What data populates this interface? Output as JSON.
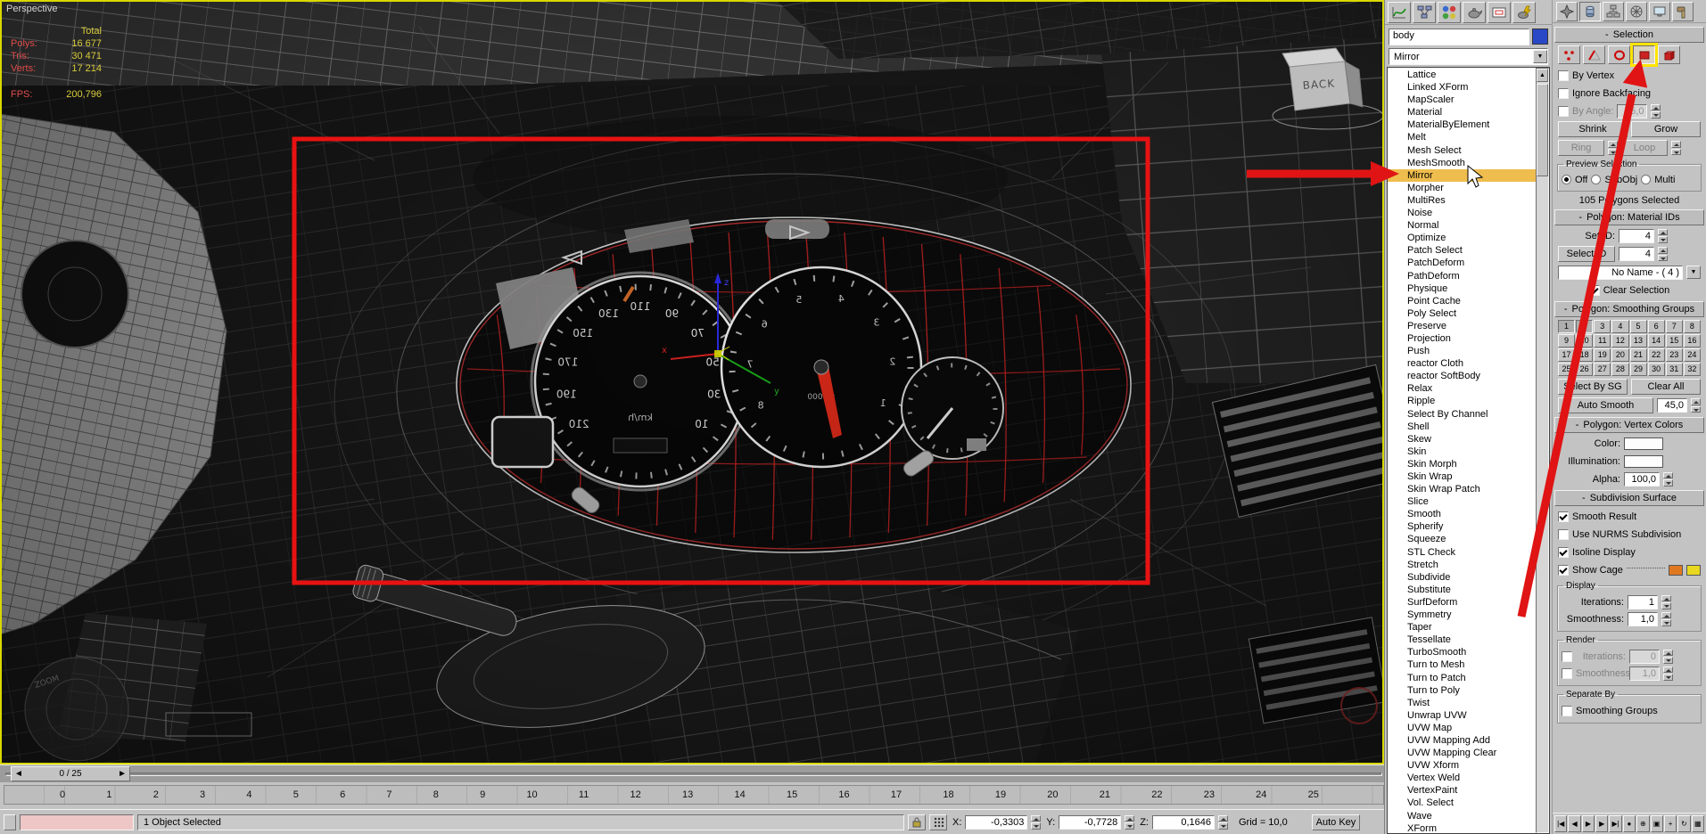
{
  "ui": {
    "collapse": "-",
    "arrow_down": "▼",
    "arrow_up_small": "▲",
    "slider_prev": "◄",
    "slider_next": "►"
  },
  "toolbar_top": {
    "icons": [
      "curve-editor",
      "schematic-view",
      "material-editor",
      "render-setup",
      "render-type",
      "quick-render"
    ]
  },
  "command_tabs": [
    "create",
    "modify",
    "hierarchy",
    "motion",
    "display",
    "utilities"
  ],
  "viewport": {
    "label": "Perspective",
    "stats": {
      "total_label": "Total",
      "polys_label": "Polys:",
      "polys": "16 677",
      "tris_label": "Tris:",
      "tris": "30 471",
      "verts_label": "Verts:",
      "verts": "17 214",
      "fps_label": "FPS:",
      "fps": "200,796"
    },
    "viewcube": "BACK",
    "nav_gizmo_label": "ZOOM",
    "gizmo_axes": {
      "x": "x",
      "y": "y",
      "z": "z"
    },
    "gauges": {
      "speed_unit": "km/h",
      "speed_ticks": [
        "10",
        "30",
        "50",
        "70",
        "90",
        "110",
        "130",
        "150",
        "170",
        "190",
        "210"
      ],
      "tacho_unit": "x 1000",
      "tacho_ticks": [
        "1",
        "2",
        "3",
        "4",
        "5",
        "6",
        "7",
        "8"
      ]
    }
  },
  "modifier_panel": {
    "object_name": "body",
    "selected": "Mirror",
    "highlighted": "Mirror",
    "modifiers": [
      "Lattice",
      "Linked XForm",
      "MapScaler",
      "Material",
      "MaterialByElement",
      "Melt",
      "Mesh Select",
      "MeshSmooth",
      "Mirror",
      "Morpher",
      "MultiRes",
      "Noise",
      "Normal",
      "Optimize",
      "Patch Select",
      "PatchDeform",
      "PathDeform",
      "Physique",
      "Point Cache",
      "Poly Select",
      "Preserve",
      "Projection",
      "Push",
      "reactor Cloth",
      "reactor SoftBody",
      "Relax",
      "Ripple",
      "Select By Channel",
      "Shell",
      "Skew",
      "Skin",
      "Skin Morph",
      "Skin Wrap",
      "Skin Wrap Patch",
      "Slice",
      "Smooth",
      "Spherify",
      "Squeeze",
      "STL Check",
      "Stretch",
      "Subdivide",
      "Substitute",
      "SurfDeform",
      "Symmetry",
      "Taper",
      "Tessellate",
      "TurboSmooth",
      "Turn to Mesh",
      "Turn to Patch",
      "Turn to Poly",
      "Twist",
      "Unwrap UVW",
      "UVW Map",
      "UVW Mapping Add",
      "UVW Mapping Clear",
      "UVW Xform",
      "Vertex Weld",
      "VertexPaint",
      "Vol. Select",
      "Wave",
      "XForm"
    ]
  },
  "selection_rollout": {
    "title": "Selection",
    "by_vertex": "By Vertex",
    "ignore_backfacing": "Ignore Backfacing",
    "by_angle": "By Angle:",
    "by_angle_value": "45,0",
    "shrink": "Shrink",
    "grow": "Grow",
    "ring": "Ring",
    "loop": "Loop",
    "preview_title": "Preview Selection",
    "preview_off": "Off",
    "preview_subobj": "SubObj",
    "preview_multi": "Multi",
    "status": "105 Polygons Selected"
  },
  "material_ids_rollout": {
    "title": "Polygon: Material IDs",
    "set_id": "Set ID:",
    "set_id_value": "4",
    "select_id": "Select ID",
    "select_id_value": "4",
    "name_value": "No Name - ( 4 )",
    "clear_selection": "Clear Selection"
  },
  "smoothing_rollout": {
    "title": "Polygon: Smoothing Groups",
    "groups": [
      "1",
      "2",
      "3",
      "4",
      "5",
      "6",
      "7",
      "8",
      "9",
      "10",
      "11",
      "12",
      "13",
      "14",
      "15",
      "16",
      "17",
      "18",
      "19",
      "20",
      "21",
      "22",
      "23",
      "24",
      "25",
      "26",
      "27",
      "28",
      "29",
      "30",
      "31",
      "32"
    ],
    "active": [
      "1",
      "2"
    ],
    "select_by_sg": "Select By SG",
    "clear_all": "Clear All",
    "auto_smooth": "Auto Smooth",
    "auto_smooth_value": "45,0"
  },
  "vertex_colors_rollout": {
    "title": "Polygon: Vertex Colors",
    "color": "Color:",
    "illumination": "Illumination:",
    "alpha": "Alpha:",
    "alpha_value": "100,0"
  },
  "subdivision_rollout": {
    "title": "Subdivision Surface",
    "smooth_result": "Smooth Result",
    "use_nurms": "Use NURMS Subdivision",
    "isoline": "Isoline Display",
    "show_cage": "Show Cage",
    "display_title": "Display",
    "iterations": "Iterations:",
    "iterations_value": "1",
    "smoothness": "Smoothness:",
    "smoothness_value": "1,0",
    "render_title": "Render",
    "render_iterations_value": "0",
    "render_smoothness_value": "1,0",
    "separate_title": "Separate By",
    "smoothing_groups": "Smoothing Groups"
  },
  "timeline": {
    "slider": "0 / 25",
    "ticks": [
      "0",
      "1",
      "2",
      "3",
      "4",
      "5",
      "6",
      "7",
      "8",
      "9",
      "10",
      "11",
      "12",
      "13",
      "14",
      "15",
      "16",
      "17",
      "18",
      "19",
      "20",
      "21",
      "22",
      "23",
      "24",
      "25"
    ]
  },
  "statusbar": {
    "status": "1 Object Selected",
    "x_label": "X:",
    "x_value": "-0,3303",
    "y_label": "Y:",
    "y_value": "-0,7728",
    "z_label": "Z:",
    "z_value": "0,1646",
    "grid": "Grid = 10,0",
    "auto_key": "Auto Key"
  },
  "playback": {
    "icons": [
      {
        "name": "go-to-start-button",
        "glyph": "|◀"
      },
      {
        "name": "previous-frame-button",
        "glyph": "◀"
      },
      {
        "name": "play-button",
        "glyph": "▶"
      },
      {
        "name": "next-frame-button",
        "glyph": "▶"
      },
      {
        "name": "go-to-end-button",
        "glyph": "▶|"
      },
      {
        "name": "key-mode-toggle",
        "glyph": "●"
      },
      {
        "name": "zoom-tool",
        "glyph": "⊕"
      },
      {
        "name": "zoom-extents-tool",
        "glyph": "▣"
      },
      {
        "name": "pan-tool",
        "glyph": "+"
      },
      {
        "name": "arc-rotate-tool",
        "glyph": "↻"
      },
      {
        "name": "maximize-viewport-toggle",
        "glyph": "▦"
      }
    ]
  },
  "colors": {
    "highlight": "#eebd4e",
    "selection_red": "#e81212",
    "viewport_border": "#d8d800"
  }
}
